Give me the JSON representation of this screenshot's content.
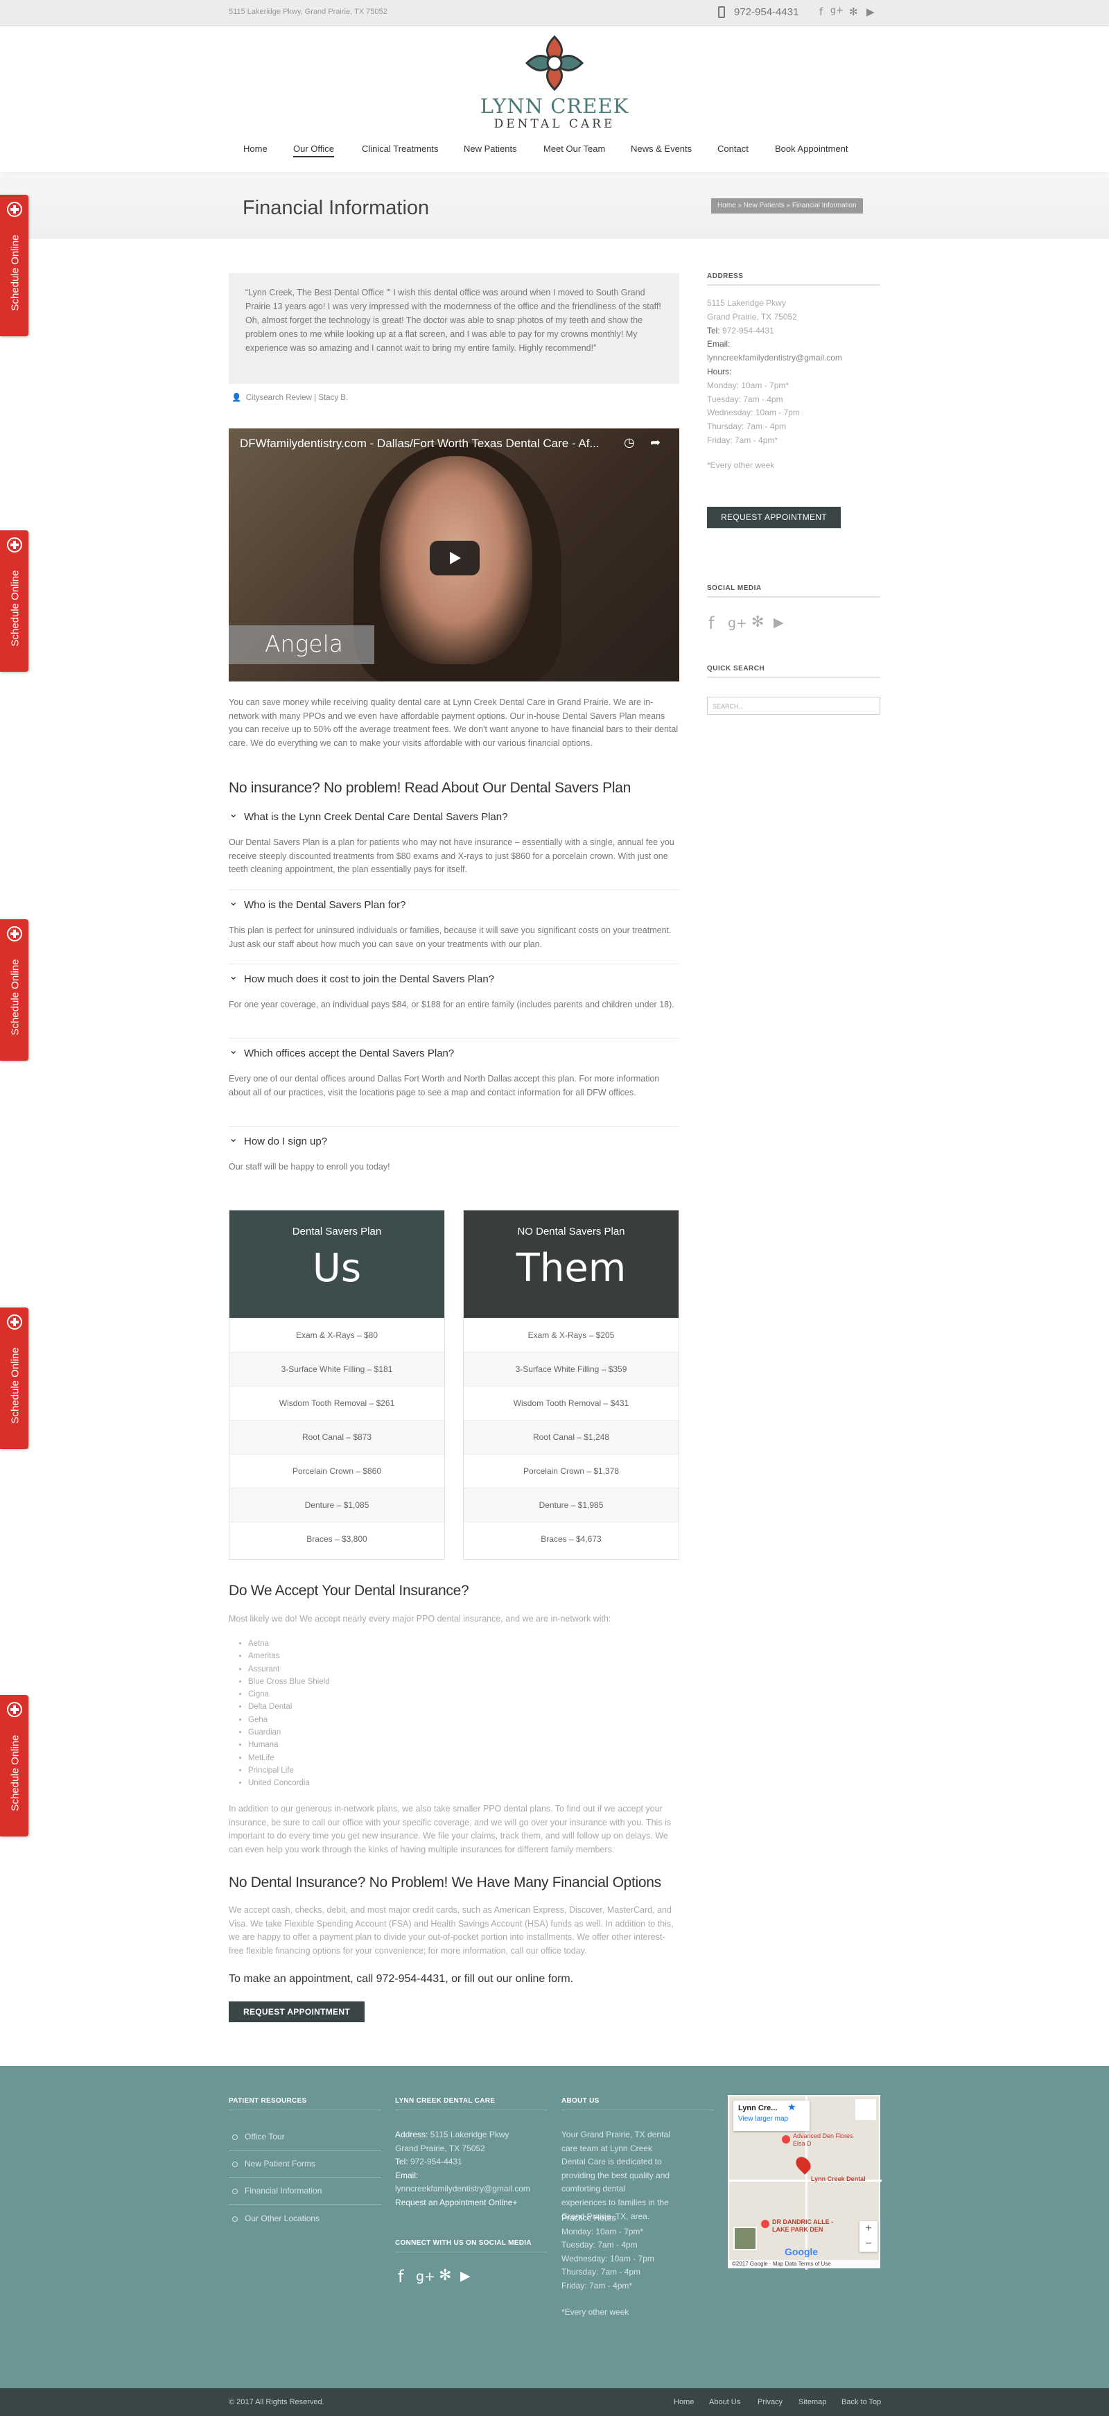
{
  "topbar": {
    "address": "5115 Lakeridge Pkwy, Grand Prairie, TX 75052",
    "phone": "972-954-4431",
    "social_icons": [
      "facebook-icon",
      "google-plus-icon",
      "yelp-icon",
      "youtube-icon"
    ]
  },
  "logo": {
    "name": "LYNN CREEK",
    "sub": "DENTAL CARE"
  },
  "nav": [
    "Home",
    "Our Office",
    "Clinical Treatments",
    "New Patients",
    "Meet Our Team",
    "News & Events",
    "Contact",
    "Book Appointment"
  ],
  "page_title": "Financial Information",
  "breadcrumb": "Home  »  New Patients  »  Financial Information",
  "schedule_tab": "Schedule Online",
  "testimonial": {
    "text": "“Lynn Creek, The Best Dental Office ”' I wish this dental office was around when I moved to South Grand Prairie 13 years ago! I was very impressed with the modernness of the office and the friendliness of the staff! Oh, almost forget the technology is great! The doctor was able to snap photos of my teeth and show the problem ones to me while looking up at a flat screen, and I was able to pay for my crowns monthly! My experience was so amazing and I cannot wait to bring my entire family. Highly recommend!”",
    "author": "Citysearch Review  |  Stacy B."
  },
  "video": {
    "title": "DFWfamilydentistry.com - Dallas/Fort Worth Texas Dental Care - Af...",
    "caption": "Angela"
  },
  "intro": "You can save money while receiving quality dental care at Lynn Creek Dental Care in Grand Prairie. We are in-network with many PPOs and we even have affordable payment options. Our in-house Dental Savers Plan means you can receive up to 50% off the average treatment fees. We don't want anyone to have financial bars to their dental care. We do everything we can to make your visits affordable with our various financial options.",
  "savers_heading": "No insurance? No problem! Read About Our Dental Savers Plan",
  "faqs": [
    {
      "q": "What is the Lynn Creek Dental Care Dental Savers Plan?",
      "a": "Our Dental Savers Plan is a plan for patients who may not have insurance – essentially with a single, annual fee you receive steeply discounted treatments from $80 exams and X-rays to just $860 for a porcelain crown. With just one teeth cleaning appointment, the plan essentially pays for itself."
    },
    {
      "q": "Who is the Dental Savers Plan for?",
      "a": "This plan is perfect for uninsured individuals or families, because it will save you significant costs on your treatment. Just ask our staff about how much you can save on your treatments with our plan."
    },
    {
      "q": "How much does it cost to join the Dental Savers Plan?",
      "a": "For one year coverage, an individual pays $84, or $188 for an entire family (includes parents and children under 18)."
    },
    {
      "q": "Which offices accept the Dental Savers Plan?",
      "a": "Every one of our dental offices around Dallas Fort Worth and North Dallas accept this plan. For more information about all of our practices, visit the locations page to see a map and contact information for all DFW offices."
    },
    {
      "q": "How do I sign up?",
      "a": "Our staff will be happy to enroll you today!"
    }
  ],
  "plans": [
    {
      "title": "Dental Savers Plan",
      "big": "Us",
      "color": "#3d4d4c",
      "rows": [
        "Exam & X-Rays – $80",
        "3-Surface White Filling – $181",
        "Wisdom Tooth Removal – $261",
        "Root Canal – $873",
        "Porcelain Crown – $860",
        "Denture – $1,085",
        "Braces – $3,800"
      ]
    },
    {
      "title": "NO Dental Savers Plan",
      "big": "Them",
      "color": "#3a3d3d",
      "rows": [
        "Exam & X-Rays – $205",
        "3-Surface White Filling – $359",
        "Wisdom Tooth Removal – $431",
        "Root Canal – $1,248",
        "Porcelain Crown – $1,378",
        "Denture – $1,985",
        "Braces – $4,673"
      ]
    }
  ],
  "insurance": {
    "heading": "Do We Accept Your Dental Insurance?",
    "lead": "Most likely we do! We accept nearly every major PPO dental insurance, and we are in-network with:",
    "list": [
      "Aetna",
      "Ameritas",
      "Assurant",
      "Blue Cross Blue Shield",
      "Cigna",
      "Delta Dental",
      "Geha",
      "Guardian",
      "Humana",
      "MetLife",
      "Principal Life",
      "United Concordia"
    ],
    "body": "In addition to our generous in-network plans, we also take smaller PPO dental plans. To find out if we accept your insurance, be sure to call our office with your specific coverage, and we will go over your insurance with you. This is important to do every time you get new insurance. We file your claims, track them, and will follow up on delays. We can even help you work through the kinks of having multiple insurances for different family members."
  },
  "financial": {
    "heading": "No Dental Insurance? No Problem! We Have Many Financial Options",
    "body": "We accept cash, checks, debit, and most major credit cards, such as American Express, Discover, MasterCard, and Visa. We take Flexible Spending Account (FSA) and Health Savings Account (HSA) funds as well. In addition to this, we are happy to offer a payment plan to divide your out-of-pocket portion into installments. We offer other interest-free flexible financing options for your convenience; for more information, call our office today.",
    "cta": "To make an appointment, call 972-954-4431, or fill out our online form.",
    "button": "REQUEST APPOINTMENT"
  },
  "sidebar": {
    "address_heading": "ADDRESS",
    "street": "5115 Lakeridge Pkwy",
    "city": "Grand Prairie, TX 75052",
    "tel_label": "Tel:",
    "tel": "972-954-4431",
    "email_label": "Email:",
    "email": "lynncreekfamilydentistry@gmail.com",
    "hours_label": "Hours:",
    "hours": [
      "Monday: 10am - 7pm*",
      "Tuesday: 7am - 4pm",
      "Wednesday: 10am - 7pm",
      "Thursday: 7am - 4pm",
      "Friday: 7am - 4pm*"
    ],
    "note": "*Every other week",
    "button": "REQUEST APPOINTMENT",
    "social_heading": "SOCIAL MEDIA",
    "search_heading": "QUICK SEARCH",
    "search_placeholder": "SEARCH..."
  },
  "footer": {
    "resources_heading": "PATIENT RESOURCES",
    "resources": [
      "Office Tour",
      "New Patient Forms",
      "Financial Information",
      "Our Other Locations"
    ],
    "lcdc_heading": "LYNN CREEK DENTAL CARE",
    "address_label": "Address:",
    "street": "5115 Lakeridge Pkwy",
    "city": "Grand Prairie, TX 75052",
    "tel_label": "Tel:",
    "tel": "972-954-4431",
    "email_label": "Email:",
    "email": "lynncreekfamilydentistry@gmail.com",
    "request_link": "Request an Appointment Online+",
    "connect_heading": "CONNECT WITH US ON SOCIAL MEDIA",
    "about_heading": "ABOUT US",
    "about": "Your Grand Prairie, TX dental care team at Lynn Creek Dental Care is dedicated to providing the best quality and comforting dental experiences to families in the Grand Prairie, TX, area.",
    "hours_heading": "Practice Hours",
    "hours": [
      "Monday: 10am - 7pm*",
      "Tuesday: 7am - 4pm",
      "Wednesday: 10am - 7pm",
      "Thursday: 7am - 4pm",
      "Friday: 7am - 4pm*"
    ],
    "note": "*Every other week",
    "map": {
      "title": "Lynn Cre...",
      "link": "View larger map",
      "pin1": "Advanced Den Flores Elsa D",
      "pin2": "Lynn Creek Dental",
      "pin3": "DR DANDRIC ALLE - LAKE PARK DEN",
      "attribution": "©2017 Google · Map Data    Terms of Use"
    }
  },
  "bottom": {
    "copyright": "© 2017 All Rights Reserved.",
    "links": [
      "Home",
      "About Us",
      "Privacy",
      "Sitemap",
      "Back to Top"
    ]
  }
}
